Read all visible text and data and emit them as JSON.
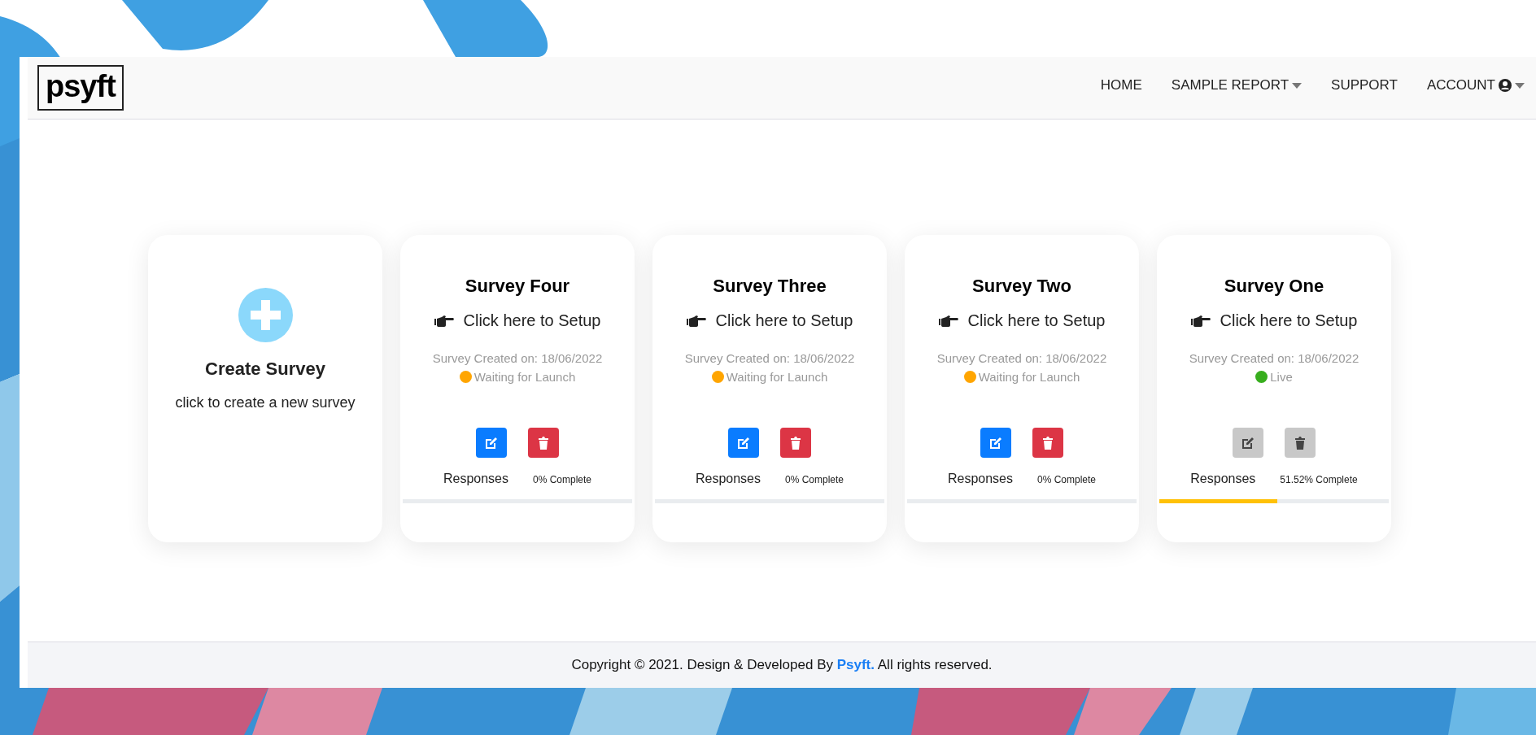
{
  "navbar": {
    "logo": "psyft",
    "links": [
      {
        "label": "HOME",
        "kind": "plain",
        "dropdown": false
      },
      {
        "label": "SAMPLE REPORT",
        "kind": "plain",
        "dropdown": true
      },
      {
        "label": "SUPPORT",
        "kind": "plain",
        "dropdown": false
      },
      {
        "label": "ACCOUNT",
        "kind": "account",
        "dropdown": true
      }
    ]
  },
  "create_card": {
    "title": "Create Survey",
    "subtitle": "click to create a new survey"
  },
  "surveys": [
    {
      "title": "Survey Four",
      "setup_link": "Click here to Setup",
      "created": "Survey Created on: 18/06/2022",
      "status": "Waiting for Launch",
      "color": "#ffa500",
      "actions_disabled": false,
      "responses_label": "Responses",
      "complete": "0% Complete",
      "level": 0
    },
    {
      "title": "Survey Three",
      "setup_link": "Click here to Setup",
      "created": "Survey Created on: 18/06/2022",
      "status": "Waiting for Launch",
      "color": "#ffa500",
      "actions_disabled": false,
      "responses_label": "Responses",
      "complete": "0% Complete",
      "level": 0
    },
    {
      "title": "Survey Two",
      "setup_link": "Click here to Setup",
      "created": "Survey Created on: 18/06/2022",
      "status": "Waiting for Launch",
      "color": "#ffa500",
      "actions_disabled": false,
      "responses_label": "Responses",
      "complete": "0% Complete",
      "level": 0
    },
    {
      "title": "Survey One",
      "setup_link": "Click here to Setup",
      "created": "Survey Created on: 18/06/2022",
      "status": "Live",
      "color": "#38ae1e",
      "actions_disabled": true,
      "responses_label": "Responses",
      "complete": "51.52% Complete",
      "level": 0.5152
    }
  ],
  "footer": {
    "text": "Copyright © 2021. Design & Developed By **Psyft.** All rights reserved."
  }
}
